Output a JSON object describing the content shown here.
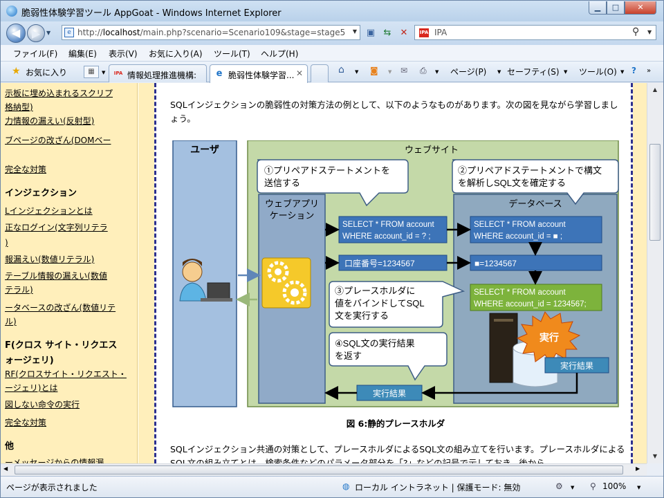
{
  "window": {
    "title": "脆弱性体験学習ツール AppGoat - Windows Internet Explorer"
  },
  "address": {
    "url_prefix": "http://",
    "url_host": "localhost",
    "url_path": "/main.php?scenario=Scenario109&stage=stage5"
  },
  "search": {
    "provider": "IPA",
    "logo": "IPA"
  },
  "menu": [
    "ファイル(F)",
    "編集(E)",
    "表示(V)",
    "お気に入り(A)",
    "ツール(T)",
    "ヘルプ(H)"
  ],
  "favorites": {
    "label": "お気に入り"
  },
  "tabs": [
    {
      "label": "情報処理推進機構:",
      "icon": "IPA"
    },
    {
      "label": "脆弱性体験学習...",
      "icon": "e"
    }
  ],
  "toolbar": {
    "page": "ページ(P)",
    "safety": "セーフティ(S)",
    "tools": "ツール(O)",
    "help_icon": "help-icon"
  },
  "sidebar": [
    {
      "text": "示板に埋め込まれるスクリプ",
      "type": "link"
    },
    {
      "text": "格納型)",
      "type": "link"
    },
    {
      "text": "力情報の漏えい(反射型)",
      "type": "link"
    },
    {
      "text": "ブページの改ざん(DOMベー",
      "type": "link"
    },
    {
      "text": "完全な対策",
      "type": "link"
    },
    {
      "text": "インジェクション",
      "type": "head"
    },
    {
      "text": "Lインジェクションとは",
      "type": "link"
    },
    {
      "text": "正なログイン(文字列リテラ",
      "type": "link"
    },
    {
      "text": ")",
      "type": "link"
    },
    {
      "text": "報漏えい(数値リテラル)",
      "type": "link"
    },
    {
      "text": "テーブル情報の漏えい(数値",
      "type": "link"
    },
    {
      "text": "テラル)",
      "type": "link"
    },
    {
      "text": "ータベースの改ざん(数値リテ",
      "type": "link"
    },
    {
      "text": "ル)",
      "type": "link"
    },
    {
      "text": "F(クロス サイト・リクエス",
      "type": "head"
    },
    {
      "text": "ォージェリ)",
      "type": "head"
    },
    {
      "text": "RF(クロスサイト・リクエスト・",
      "type": "link"
    },
    {
      "text": "ージェリ)とは",
      "type": "link"
    },
    {
      "text": "図しない命令の実行",
      "type": "link"
    },
    {
      "text": "完全な対策",
      "type": "link"
    },
    {
      "text": "他",
      "type": "head"
    },
    {
      "text": "ーメッセージからの情報漏",
      "type": "link"
    }
  ],
  "main": {
    "intro": "SQLインジェクションの脆弱性の対策方法の例として、以下のようなものがあります。次の図を見ながら学習しましょう。",
    "caption": "図 6:静的プレースホルダ",
    "para2": "SQLインジェクション共通の対策として、プレースホルダによるSQL文の組み立てを行います。プレースホルダによるSQL文の組み立てとは、検索条件などのパラメータ部分を「?」などの記号で示しておき、後から"
  },
  "diagram": {
    "user_label": "ユーザ",
    "website_label": "ウェブサイト",
    "app_label": "ウェブアプリ\nケーション",
    "db_label": "データベース",
    "bubble1": "①プリペアドステートメントを\n送信する",
    "bubble2": "②プリペアドステートメントで構文\nを解析しSQL文を確定する",
    "bubble3": "③プレースホルダに\n値をバインドしてSQL\n文を実行する",
    "bubble4": "④SQL文の実行結果\nを返す",
    "sql_app": "SELECT * FROM account\nWHERE account_id = ? ;",
    "sql_db": "SELECT * FROM account\nWHERE account_id = ■ ;",
    "param_app": "口座番号=1234567",
    "param_db": "■=1234567",
    "sql_exec": "SELECT * FROM account\nWHERE account_id = 1234567;",
    "exec_star": "実行",
    "result_db": "実行結果",
    "result_app": "実行結果"
  },
  "statusbar": {
    "status": "ページが表示されました",
    "zone": "ローカル イントラネット | 保護モード: 無効",
    "zoom": "100%"
  },
  "colors": {
    "sidebar_bg": "#ffefbb",
    "accent_blue": "#3d74b8",
    "db_green": "#7db33c"
  }
}
